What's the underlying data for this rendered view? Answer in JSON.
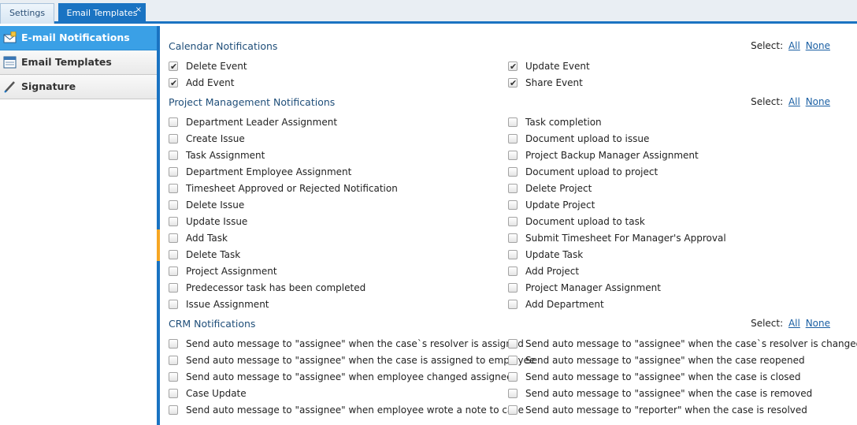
{
  "tabs": [
    {
      "label": "Settings"
    },
    {
      "label": "Email Templates",
      "close": "×"
    }
  ],
  "sidebar": {
    "items": [
      {
        "label": "E-mail Notifications",
        "icon": "envelope-icon"
      },
      {
        "label": "Email Templates",
        "icon": "template-icon"
      },
      {
        "label": "Signature",
        "icon": "pen-icon"
      }
    ]
  },
  "select": {
    "label": "Select:",
    "all": "All",
    "none": "None"
  },
  "sections": [
    {
      "title": "Calendar Notifications",
      "left": [
        {
          "label": "Delete Event",
          "checked": true
        },
        {
          "label": "Add Event",
          "checked": true
        }
      ],
      "right": [
        {
          "label": "Update Event",
          "checked": true
        },
        {
          "label": "Share Event",
          "checked": true
        }
      ]
    },
    {
      "title": "Project Management Notifications",
      "left": [
        {
          "label": "Department Leader Assignment",
          "checked": false
        },
        {
          "label": "Create Issue",
          "checked": false
        },
        {
          "label": "Task Assignment",
          "checked": false
        },
        {
          "label": "Department Employee Assignment",
          "checked": false
        },
        {
          "label": "Timesheet Approved or Rejected Notification",
          "checked": false
        },
        {
          "label": "Delete Issue",
          "checked": false
        },
        {
          "label": "Update Issue",
          "checked": false
        },
        {
          "label": "Add Task",
          "checked": false
        },
        {
          "label": "Delete Task",
          "checked": false
        },
        {
          "label": "Project Assignment",
          "checked": false
        },
        {
          "label": "Predecessor task has been completed",
          "checked": false
        },
        {
          "label": "Issue Assignment",
          "checked": false
        }
      ],
      "right": [
        {
          "label": "Task completion",
          "checked": false
        },
        {
          "label": "Document upload to issue",
          "checked": false
        },
        {
          "label": "Project Backup Manager Assignment",
          "checked": false
        },
        {
          "label": "Document upload to project",
          "checked": false
        },
        {
          "label": "Delete Project",
          "checked": false
        },
        {
          "label": "Update Project",
          "checked": false
        },
        {
          "label": "Document upload to task",
          "checked": false
        },
        {
          "label": "Submit Timesheet For Manager's Approval",
          "checked": false
        },
        {
          "label": "Update Task",
          "checked": false
        },
        {
          "label": "Add Project",
          "checked": false
        },
        {
          "label": "Project Manager Assignment",
          "checked": false
        },
        {
          "label": "Add Department",
          "checked": false
        }
      ]
    },
    {
      "title": "CRM Notifications",
      "left": [
        {
          "label": "Send auto message to \"assignee\" when the case`s resolver is assigned",
          "checked": false
        },
        {
          "label": "Send auto message to \"assignee\" when the case is assigned to employee",
          "checked": false
        },
        {
          "label": "Send auto message to \"assignee\" when employee changed assignee",
          "checked": false
        },
        {
          "label": "Case Update",
          "checked": false
        },
        {
          "label": "Send auto message to \"assignee\" when employee wrote a note to case",
          "checked": false
        }
      ],
      "right": [
        {
          "label": "Send auto message to \"assignee\" when the case`s resolver is changed",
          "checked": false
        },
        {
          "label": "Send auto message to \"assignee\" when the case reopened",
          "checked": false
        },
        {
          "label": "Send auto message to \"assignee\" when the case is closed",
          "checked": false
        },
        {
          "label": "Send auto message to \"assignee\" when the case is removed",
          "checked": false
        },
        {
          "label": "Send auto message to \"reporter\" when the case is resolved",
          "checked": false
        }
      ]
    }
  ]
}
